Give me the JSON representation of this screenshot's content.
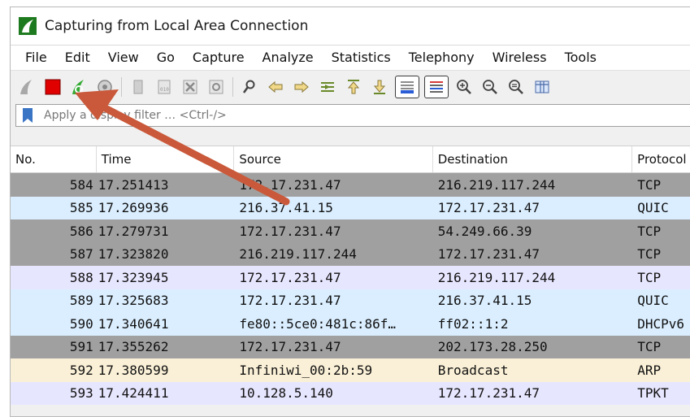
{
  "window": {
    "title": "Capturing from Local Area Connection"
  },
  "menu": [
    "File",
    "Edit",
    "View",
    "Go",
    "Capture",
    "Analyze",
    "Statistics",
    "Telephony",
    "Wireless",
    "Tools"
  ],
  "filter": {
    "placeholder": "Apply a display filter … <Ctrl-/>"
  },
  "table": {
    "headers": [
      "No.",
      "Time",
      "Source",
      "Destination",
      "Protocol"
    ],
    "rows": [
      {
        "no": "584",
        "time": "17.251413",
        "source": "172.17.231.47",
        "destination": "216.219.117.244",
        "protocol": "TCP",
        "color": "#a0a0a0"
      },
      {
        "no": "585",
        "time": "17.269936",
        "source": "216.37.41.15",
        "destination": "172.17.231.47",
        "protocol": "QUIC",
        "color": "#daeeff"
      },
      {
        "no": "586",
        "time": "17.279731",
        "source": "172.17.231.47",
        "destination": "54.249.66.39",
        "protocol": "TCP",
        "color": "#a0a0a0"
      },
      {
        "no": "587",
        "time": "17.323820",
        "source": "216.219.117.244",
        "destination": "172.17.231.47",
        "protocol": "TCP",
        "color": "#a0a0a0"
      },
      {
        "no": "588",
        "time": "17.323945",
        "source": "172.17.231.47",
        "destination": "216.219.117.244",
        "protocol": "TCP",
        "color": "#e7e6ff"
      },
      {
        "no": "589",
        "time": "17.325683",
        "source": "172.17.231.47",
        "destination": "216.37.41.15",
        "protocol": "QUIC",
        "color": "#daeeff"
      },
      {
        "no": "590",
        "time": "17.340641",
        "source": "fe80::5ce0:481c:86f…",
        "destination": "ff02::1:2",
        "protocol": "DHCPv6",
        "color": "#daeeff"
      },
      {
        "no": "591",
        "time": "17.355262",
        "source": "172.17.231.47",
        "destination": "202.173.28.250",
        "protocol": "TCP",
        "color": "#a0a0a0"
      },
      {
        "no": "592",
        "time": "17.380599",
        "source": "Infiniwi_00:2b:59",
        "destination": "Broadcast",
        "protocol": "ARP",
        "color": "#faf0d7"
      },
      {
        "no": "593",
        "time": "17.424411",
        "source": "10.128.5.140",
        "destination": "172.17.231.47",
        "protocol": "TPKT",
        "color": "#e7e6ff"
      }
    ]
  },
  "colors": {
    "stop_red": "#e00000",
    "fin_green": "#33aa33",
    "arrow": "#c9593a"
  },
  "icons": [
    "start-capture-icon",
    "stop-capture-icon",
    "restart-capture-icon",
    "capture-options-icon",
    "open-file-icon",
    "save-file-icon",
    "close-file-icon",
    "reload-file-icon",
    "find-packet-icon",
    "go-back-icon",
    "go-forward-icon",
    "go-to-packet-icon",
    "first-packet-icon",
    "last-packet-icon",
    "autoscroll-icon",
    "colorize-icon",
    "zoom-in-icon",
    "zoom-out-icon",
    "normal-size-icon",
    "resize-columns-icon"
  ]
}
